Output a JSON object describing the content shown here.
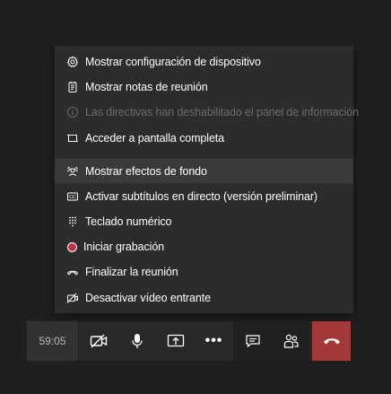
{
  "menu": {
    "items": [
      {
        "label": "Mostrar configuración de dispositivo",
        "icon": "gear-icon",
        "disabled": false
      },
      {
        "label": "Mostrar notas de reunión",
        "icon": "notes-icon",
        "disabled": false
      },
      {
        "label": "Las directivas han deshabilitado el panel de información",
        "icon": "info-icon",
        "disabled": true
      },
      {
        "label": "Acceder a pantalla completa",
        "icon": "fullscreen-icon",
        "disabled": false
      },
      {
        "label": "Mostrar efectos de fondo",
        "icon": "background-effects-icon",
        "disabled": false,
        "highlighted": true
      },
      {
        "label": "Activar subtítulos en directo (versión preliminar)",
        "icon": "captions-icon",
        "disabled": false
      },
      {
        "label": "Teclado numérico",
        "icon": "dialpad-icon",
        "disabled": false
      },
      {
        "label": "Iniciar grabación",
        "icon": "record-icon",
        "disabled": false
      },
      {
        "label": "Finalizar la reunión",
        "icon": "end-call-icon",
        "disabled": false
      },
      {
        "label": "Desactivar vídeo entrante",
        "icon": "video-off-icon",
        "disabled": false
      }
    ]
  },
  "toolbar": {
    "timer": "59:05",
    "more_label": "•••",
    "buttons": [
      {
        "name": "camera-off-button",
        "icon": "camera-off-icon"
      },
      {
        "name": "microphone-button",
        "icon": "microphone-icon"
      },
      {
        "name": "share-screen-button",
        "icon": "share-screen-icon"
      },
      {
        "name": "more-actions-button",
        "icon": "more-icon"
      },
      {
        "name": "chat-button",
        "icon": "chat-icon"
      },
      {
        "name": "participants-button",
        "icon": "participants-icon"
      },
      {
        "name": "hang-up-button",
        "icon": "hang-up-icon"
      }
    ]
  },
  "colors": {
    "background": "#1f1f1f",
    "menu": "#2d2c2c",
    "highlight": "#3b3a3a",
    "hangup": "#a4373a",
    "record": "#c4314b",
    "disabled_text": "#6b6b6b"
  }
}
